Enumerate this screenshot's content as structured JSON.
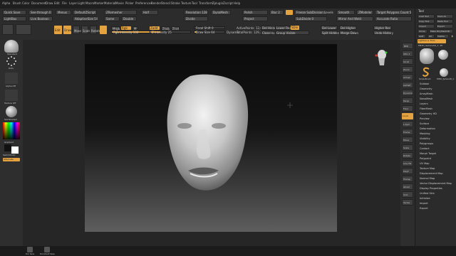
{
  "menu": [
    "Alpha",
    "Brush",
    "Color",
    "Document",
    "Draw",
    "Edit",
    "File",
    "Layer",
    "Light",
    "Macro",
    "Marker",
    "Material",
    "Movie",
    "Picker",
    "Preferences",
    "Render",
    "Stencil",
    "Stroke",
    "Texture",
    "Tool",
    "Transform",
    "Zplugin",
    "Zscript",
    "Help"
  ],
  "toolbar": {
    "quick_save": "Quick Save",
    "see_through": "See-through 0",
    "menus": "Menus",
    "default_zscript": "DefaultZScript",
    "lightbox": "LightBox",
    "live_boolean": "Live Boolean",
    "edit": "Edit",
    "draw": "Draw",
    "move": "Move",
    "scale": "Scale",
    "rotate": "Rotate",
    "mrgb": "Mrgb",
    "rgb": "Rgb",
    "m": "M",
    "zadd": "Zadd",
    "zsub": "Zsub",
    "zcut": "Zcut",
    "rgb_intensity": "Rgb Intensity 100",
    "z_intensity": "Z Intensity 25",
    "focal_shift": "Focal Shift 0",
    "draw_size": "Draw Size 64",
    "dynamic": "Dynamic",
    "active_points": "ActivePoints: 12,074",
    "total_points": "TotalPoints: 129,315",
    "x": "X",
    "y": "Y",
    "z": "Z",
    "persp": "Persp",
    "floor": "Floor",
    "local": "Local",
    "lsym": "L.Sym",
    "zremesher": "ZRemesher",
    "target_polygons": "Target Polygons Count 5",
    "adaptive_size": "AdaptiveSize 50",
    "half": "Half",
    "same": "Same",
    "double": "Double",
    "adapt": "Adapt",
    "freeze_subdiv": "Freeze SubDivision Levels",
    "smooth": "Smooth",
    "mirror_weld": "Mirror And Weld",
    "zmodeler": "ZModeler",
    "dynamesh": "DynaMesh",
    "resolution": "Resolution 128",
    "polish": "Polish",
    "blur": "Blur 2",
    "proj": "Project",
    "del_hidden": "Del Hidden",
    "close_holes": "Close Holes",
    "sdiv": "SDiv",
    "lower_res": "Lower Res",
    "higher_res": "Higher Res",
    "divide": "Divide",
    "del_lower": "Del Lower",
    "del_higher": "Del Higher",
    "subdivide": "SubDivide 0",
    "group_visible": "Group Visible",
    "split_hidden": "Split Hidden",
    "merge_down": "Merge Down",
    "accurate_ratio": "Accurate Ratio",
    "undo_history": "Undo History"
  },
  "leftshelf": {
    "brush_label": "Standard",
    "stroke_label": "Dots",
    "alpha_label": "Alpha Off",
    "texture_label": "Texture Off",
    "material_label": "SkinShade4",
    "gradient": "Gradient",
    "switch_color": "SwitchColor",
    "alternate": "Alternate"
  },
  "rightshelf": {
    "items": [
      "BPR",
      "SPix 3",
      "Scroll",
      "Zoom",
      "Actual",
      "AAHalf",
      "Dynamic",
      "Persp",
      "Floor",
      "Local",
      "L.Sym",
      "Frame",
      "Move",
      "Scale",
      "Rotate",
      "Line Fill",
      "PolyF",
      "Transp",
      "Ghost",
      "Solo",
      "Xpose"
    ]
  },
  "palette": {
    "title": "Tool",
    "load_tool": "Load Tool",
    "save_as": "Save As",
    "copy_tool": "Copy Tool",
    "paste_tool": "Paste Tool",
    "import": "Import",
    "export": "Export",
    "clone": "Clone",
    "make_polymesh": "Make PolyMesh3D",
    "goz": "GoZ",
    "all": "All",
    "visible": "Visible",
    "r": "R",
    "lightbox_tools": "Lightbox ▸ Tools",
    "current_tool": "PM3D_Sphere3D_1. 48",
    "thumb_labels": [
      "PM3D_Sphere3D",
      "Cylinder3D",
      "SimpleBrush",
      "PM3D_Sphere3D_1"
    ],
    "sections": [
      "Subtool",
      "Geometry",
      "ArrayMesh",
      "NanoMesh",
      "Layers",
      "FiberMesh",
      "Geometry HD",
      "Preview",
      "Surface",
      "Deformation",
      "Masking",
      "Visibility",
      "Polygroups",
      "Contact",
      "Morph Target",
      "Polypaint",
      "UV Map",
      "Texture Map",
      "Displacement Map",
      "Normal Map",
      "Vector Displacement Map",
      "Display Properties",
      "Unified Skin",
      "Initialize",
      "Import",
      "Export"
    ]
  },
  "bottom": {
    "items": [
      "Doc Save",
      "Document Save"
    ]
  },
  "colors": {
    "accent": "#e5a33f",
    "panel": "#2c2c2c",
    "dark": "#1f1f1f"
  }
}
